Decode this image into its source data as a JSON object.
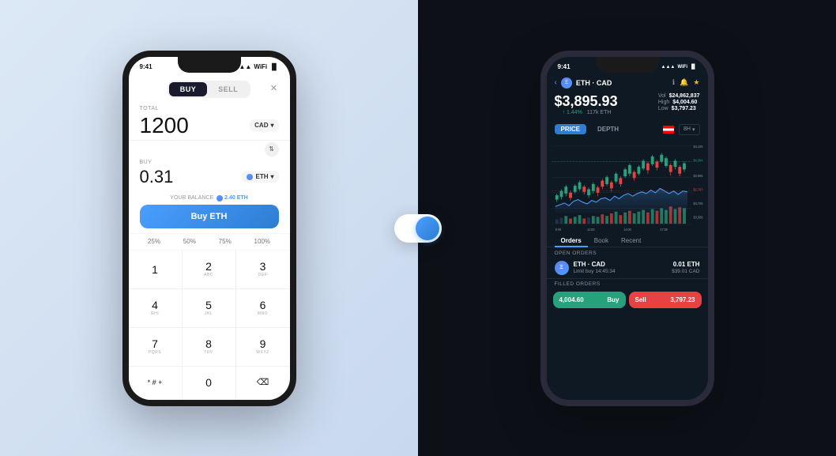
{
  "left_phone": {
    "status_time": "9:41",
    "buy_tab": "BUY",
    "sell_tab": "SELL",
    "total_label": "TOTAL",
    "amount_value": "1200",
    "currency": "CAD",
    "buy_label": "BUY",
    "buy_amount": "0.31",
    "buy_currency": "ETH",
    "balance_label": "YOUR BALANCE",
    "balance_value": "2.40 ETH",
    "buy_btn": "Buy ETH",
    "pct_25": "25%",
    "pct_50": "50%",
    "pct_75": "75%",
    "pct_100": "100%",
    "keys": [
      {
        "num": "1",
        "letters": ""
      },
      {
        "num": "2",
        "letters": "ABC"
      },
      {
        "num": "3",
        "letters": "DEF"
      },
      {
        "num": "4",
        "letters": "GHI"
      },
      {
        "num": "5",
        "letters": "JKL"
      },
      {
        "num": "6",
        "letters": "MNO"
      },
      {
        "num": "7",
        "letters": "PQRS"
      },
      {
        "num": "8",
        "letters": "TUV"
      },
      {
        "num": "9",
        "letters": "WXYZ"
      },
      {
        "num": "* # +",
        "letters": ""
      },
      {
        "num": "0",
        "letters": ""
      },
      {
        "num": "⌫",
        "letters": ""
      }
    ]
  },
  "right_phone": {
    "status_time": "9:41",
    "pair": "ETH · CAD",
    "price": "$3,895.93",
    "vol_label": "Vol",
    "vol_value": "$24,862,837",
    "high_label": "High",
    "high_value": "$4,004.60",
    "low_label": "Low",
    "low_value": "$3,797.23",
    "change_pct": "↑ 1.44%",
    "change_vol": "117k ETH",
    "price_tab": "PRICE",
    "depth_tab": "DEPTH",
    "timeframe": "8H",
    "price_levels": [
      "$4,100.0",
      "$4,004.6",
      "$3,900.0",
      "$3,797.2",
      "$3,700.0",
      "$3,500.0"
    ],
    "time_labels": [
      "9:00",
      "11:00",
      "14:00",
      "17:00"
    ],
    "orders_tab": "Orders",
    "book_tab": "Book",
    "recent_tab": "Recent",
    "open_orders_label": "OPEN ORDERS",
    "order_pair": "ETH · CAD",
    "order_type": "Limit buy 14:45:34",
    "order_eth": "0.01 ETH",
    "order_cad": "$39.01 CAD",
    "filled_orders_label": "FILLED ORDERS",
    "buy_price": "4,004.60",
    "buy_label": "Buy",
    "sell_label": "Sell",
    "sell_price": "3,797.23"
  },
  "toggle": {
    "label": "toggle-theme"
  }
}
